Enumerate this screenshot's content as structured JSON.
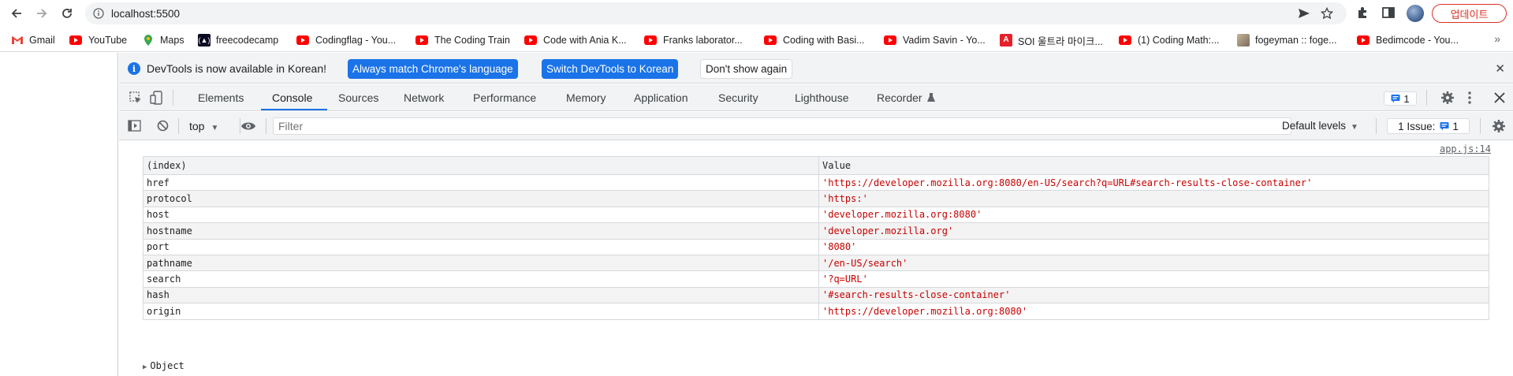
{
  "browser": {
    "url": "localhost:5500",
    "update_button": "업데이트",
    "bookmarks": [
      {
        "label": "Gmail",
        "icon": "gmail-icon"
      },
      {
        "label": "YouTube",
        "icon": "youtube-icon"
      },
      {
        "label": "Maps",
        "icon": "maps-icon"
      },
      {
        "label": "freecodecamp",
        "icon": "freecodecamp-icon"
      },
      {
        "label": "Codingflag - You...",
        "icon": "youtube-icon"
      },
      {
        "label": "The Coding Train",
        "icon": "youtube-icon"
      },
      {
        "label": "Code with Ania K...",
        "icon": "youtube-icon"
      },
      {
        "label": "Franks laborator...",
        "icon": "youtube-icon"
      },
      {
        "label": "Coding with Basi...",
        "icon": "youtube-icon"
      },
      {
        "label": "Vadim Savin - Yo...",
        "icon": "youtube-icon"
      },
      {
        "label": "SOI 울트라 마이크...",
        "icon": "soi-icon"
      },
      {
        "label": "(1) Coding Math:...",
        "icon": "youtube-icon"
      },
      {
        "label": "fogeyman :: foge...",
        "icon": "fogeyman-icon"
      },
      {
        "label": "Bedimcode - You...",
        "icon": "youtube-icon"
      }
    ]
  },
  "devtools": {
    "infobar": {
      "message": "DevTools is now available in Korean!",
      "btn_match": "Always match Chrome's language",
      "btn_switch": "Switch DevTools to Korean",
      "btn_dismiss": "Don't show again"
    },
    "tabs": [
      "Elements",
      "Console",
      "Sources",
      "Network",
      "Performance",
      "Memory",
      "Application",
      "Security",
      "Lighthouse",
      "Recorder"
    ],
    "active_tab": "Console",
    "issues_badge": "1",
    "context": "top",
    "filter_placeholder": "Filter",
    "levels": "Default levels",
    "issue_count": "1 Issue:",
    "issue_count_n": "1",
    "console": {
      "source": "app.js:14",
      "headers": [
        "(index)",
        "Value"
      ],
      "rows": [
        {
          "key": "href",
          "value": "'https://developer.mozilla.org:8080/en-US/search?q=URL#search-results-close-container'"
        },
        {
          "key": "protocol",
          "value": "'https:'"
        },
        {
          "key": "host",
          "value": "'developer.mozilla.org:8080'"
        },
        {
          "key": "hostname",
          "value": "'developer.mozilla.org'"
        },
        {
          "key": "port",
          "value": "'8080'"
        },
        {
          "key": "pathname",
          "value": "'/en-US/search'"
        },
        {
          "key": "search",
          "value": "'?q=URL'"
        },
        {
          "key": "hash",
          "value": "'#search-results-close-container'"
        },
        {
          "key": "origin",
          "value": "'https://developer.mozilla.org:8080'"
        }
      ],
      "object_label": "Object"
    }
  },
  "colors": {
    "accent": "#1a73e8",
    "string_value": "#c80000",
    "update_red": "#d93025"
  }
}
